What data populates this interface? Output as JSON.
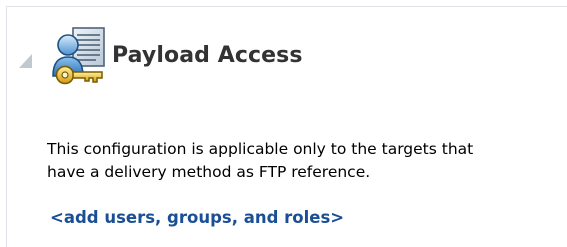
{
  "section": {
    "title": "Payload Access",
    "toggle_icon": "collapse-triangle-icon",
    "header_icon": "user-key-access-icon",
    "description_line1": "This configuration is applicable only to the targets that",
    "description_line2": "have a delivery method as FTP reference.",
    "add_link": "<add users, groups, and roles>"
  },
  "colors": {
    "title": "#333333",
    "link": "#1a4f95",
    "toggle": "#c2c8cf",
    "border": "#dfe3e8"
  }
}
